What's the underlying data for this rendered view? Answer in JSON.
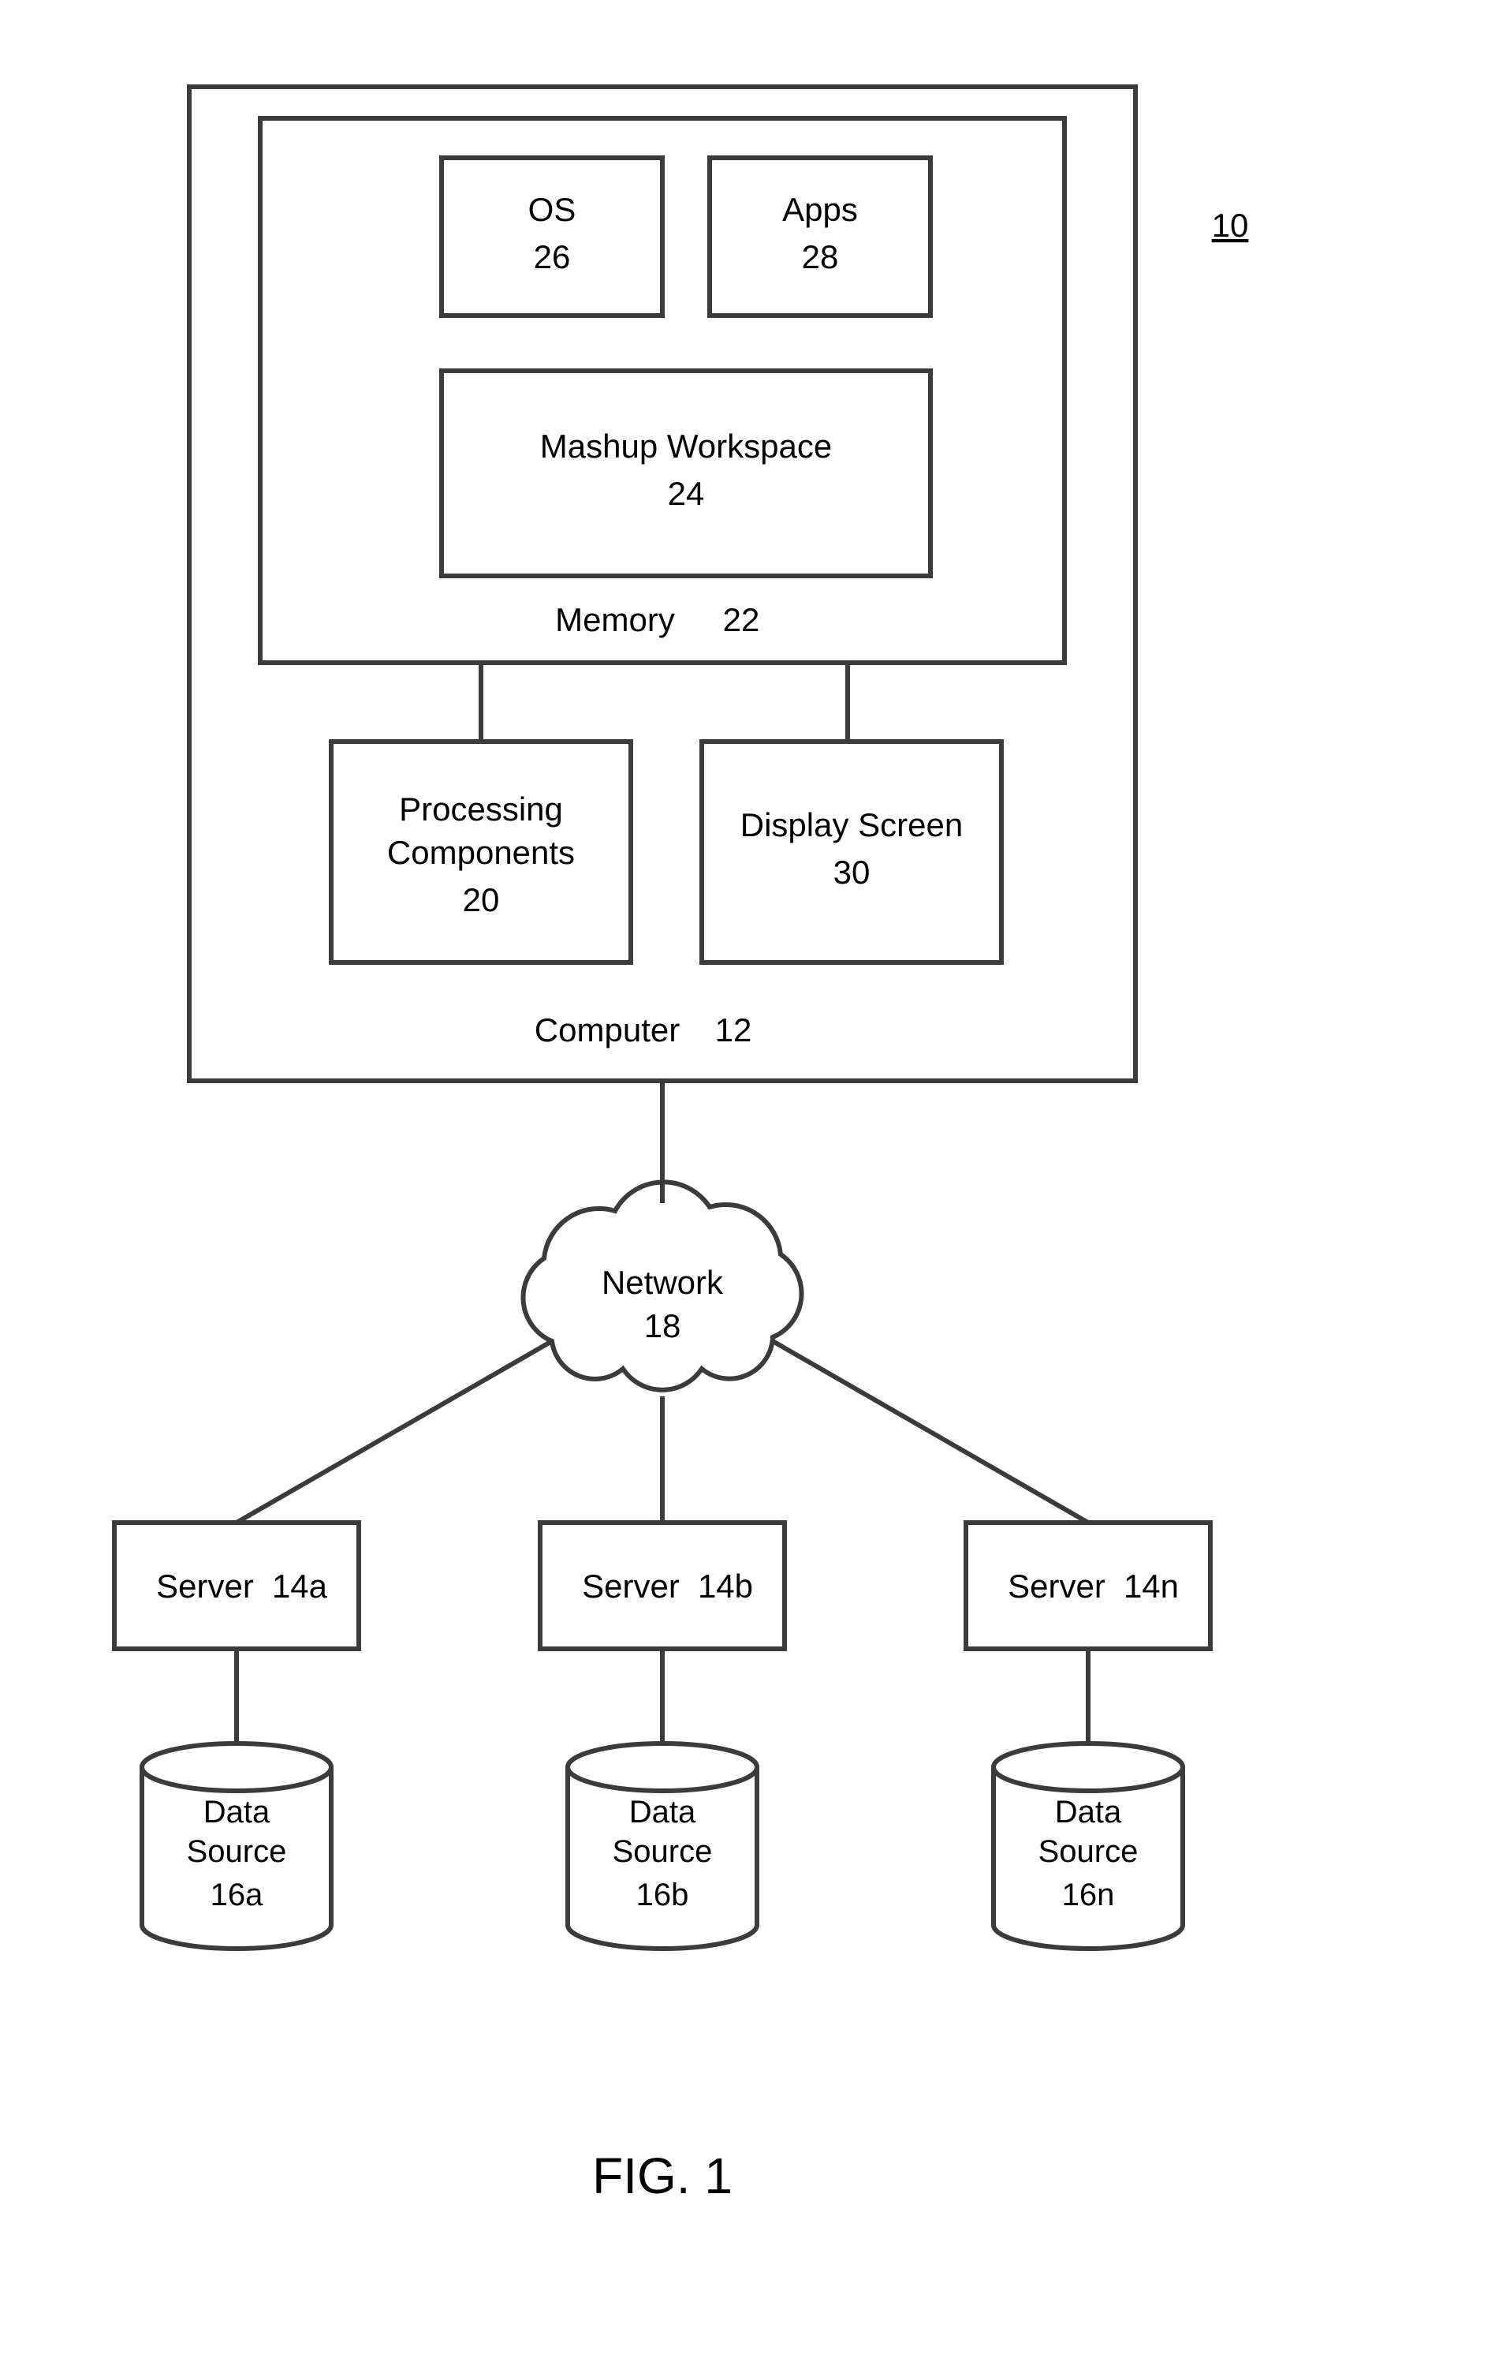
{
  "figure_label": "FIG. 1",
  "system_ref": "10",
  "computer": {
    "label": "Computer",
    "ref": "12"
  },
  "memory": {
    "label": "Memory",
    "ref": "22"
  },
  "os": {
    "label": "OS",
    "ref": "26"
  },
  "apps": {
    "label": "Apps",
    "ref": "28"
  },
  "mashup": {
    "label": "Mashup Workspace",
    "ref": "24"
  },
  "processing": {
    "label": "Processing Components",
    "ref": "20"
  },
  "display": {
    "label": "Display Screen",
    "ref": "30"
  },
  "network": {
    "label": "Network",
    "ref": "18"
  },
  "servers": [
    {
      "label": "Server",
      "ref": "14a"
    },
    {
      "label": "Server",
      "ref": "14b"
    },
    {
      "label": "Server",
      "ref": "14n"
    }
  ],
  "data_sources": [
    {
      "label1": "Data",
      "label2": "Source",
      "ref": "16a"
    },
    {
      "label1": "Data",
      "label2": "Source",
      "ref": "16b"
    },
    {
      "label1": "Data",
      "label2": "Source",
      "ref": "16n"
    }
  ]
}
